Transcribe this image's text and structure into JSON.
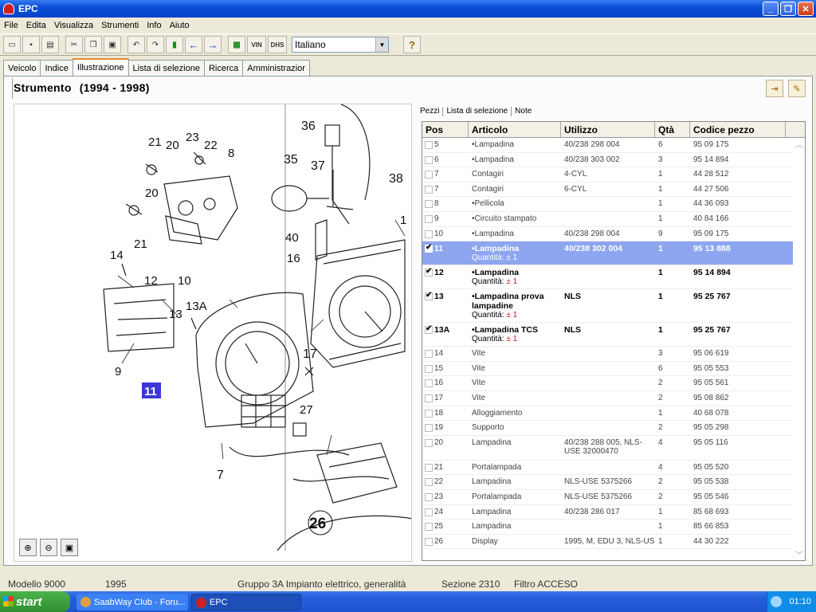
{
  "window": {
    "title": "EPC",
    "min": "_",
    "max": "❐",
    "close": "✕"
  },
  "menu": [
    "File",
    "Edita",
    "Visualizza",
    "Strumenti",
    "Info",
    "Aiuto"
  ],
  "toolbar": {
    "language": "Italiano",
    "vin_label": "VIN",
    "dhs_label": "DHS"
  },
  "tabs": [
    "Veicolo",
    "Indice",
    "Illustrazione",
    "Lista di selezione",
    "Ricerca",
    "Amministrazior"
  ],
  "active_tab": "Illustrazione",
  "page": {
    "title": "Strumento",
    "years": "(1994 - 1998)"
  },
  "subtabs": [
    "Pezzi",
    "Lista di selezione",
    "Note"
  ],
  "columns": {
    "pos": "Pos",
    "articolo": "Articolo",
    "utilizzo": "Utilizzo",
    "qta": "Qtà",
    "codice": "Codice pezzo"
  },
  "qty_label": "Quantità:",
  "rows": [
    {
      "pos": "5",
      "articolo": "•Lampadina",
      "utilizzo": "40/238 298 004",
      "qta": "6",
      "codice": "95 09 175"
    },
    {
      "pos": "6",
      "articolo": "•Lampadina",
      "utilizzo": "40/238 303 002",
      "qta": "3",
      "codice": "95 14 894"
    },
    {
      "pos": "7",
      "articolo": "Contagiri",
      "utilizzo": "4-CYL",
      "qta": "1",
      "codice": "44 28 512"
    },
    {
      "pos": "7",
      "articolo": "Contagiri",
      "utilizzo": "6-CYL",
      "qta": "1",
      "codice": "44 27 506"
    },
    {
      "pos": "8",
      "articolo": "•Pellicola",
      "utilizzo": "",
      "qta": "1",
      "codice": "44 36 093"
    },
    {
      "pos": "9",
      "articolo": "•Circuito stampato",
      "utilizzo": "",
      "qta": "1",
      "codice": "40 84 166"
    },
    {
      "pos": "10",
      "articolo": "•Lampadina",
      "utilizzo": "40/238 298 004",
      "qta": "9",
      "codice": "95 09 175"
    },
    {
      "pos": "11",
      "articolo": "•Lampadina",
      "utilizzo": "40/238 302 004",
      "qta": "1",
      "codice": "95 13 888",
      "qty": "± 1"
    },
    {
      "pos": "12",
      "articolo": "•Lampadina",
      "utilizzo": "",
      "qta": "1",
      "codice": "95 14 894",
      "qty": "± 1"
    },
    {
      "pos": "13",
      "articolo": "•Lampadina prova lampadine",
      "utilizzo": "NLS",
      "qta": "1",
      "codice": "95 25 767",
      "qty": "± 1"
    },
    {
      "pos": "13A",
      "articolo": "•Lampadina TCS",
      "utilizzo": "NLS",
      "qta": "1",
      "codice": "95 25 767",
      "qty": "± 1"
    },
    {
      "pos": "14",
      "articolo": "Vite",
      "utilizzo": "",
      "qta": "3",
      "codice": "95 06 619"
    },
    {
      "pos": "15",
      "articolo": "Vite",
      "utilizzo": "",
      "qta": "6",
      "codice": "95 05 553"
    },
    {
      "pos": "16",
      "articolo": "Vite",
      "utilizzo": "",
      "qta": "2",
      "codice": "95 05 561"
    },
    {
      "pos": "17",
      "articolo": "Vite",
      "utilizzo": "",
      "qta": "2",
      "codice": "95 08 862"
    },
    {
      "pos": "18",
      "articolo": "Alloggiamento",
      "utilizzo": "",
      "qta": "1",
      "codice": "40 68 078"
    },
    {
      "pos": "19",
      "articolo": "Supporto",
      "utilizzo": "",
      "qta": "2",
      "codice": "95 05 298"
    },
    {
      "pos": "20",
      "articolo": "Lampadina",
      "utilizzo": "40/238 288 005, NLS-USE 32000470",
      "qta": "4",
      "codice": "95 05 116"
    },
    {
      "pos": "21",
      "articolo": "Portalampada",
      "utilizzo": "",
      "qta": "4",
      "codice": "95 05 520"
    },
    {
      "pos": "22",
      "articolo": "Lampadina",
      "utilizzo": "NLS-USE 5375266",
      "qta": "2",
      "codice": "95 05 538"
    },
    {
      "pos": "23",
      "articolo": "Portalampada",
      "utilizzo": "NLS-USE 5375266",
      "qta": "2",
      "codice": "95 05 546"
    },
    {
      "pos": "24",
      "articolo": "Lampadina",
      "utilizzo": "40/238 286 017",
      "qta": "1",
      "codice": "85 68 693"
    },
    {
      "pos": "25",
      "articolo": "Lampadina",
      "utilizzo": "",
      "qta": "1",
      "codice": "85 66 853"
    },
    {
      "pos": "26",
      "articolo": "Display",
      "utilizzo": "1995, M, EDU 3, NLS-US",
      "qta": "1",
      "codice": "44 30 222"
    }
  ],
  "callouts": [
    "21",
    "20",
    "23",
    "22",
    "8",
    "36",
    "35",
    "37",
    "38",
    "20",
    "40",
    "1",
    "14",
    "21",
    "16",
    "12",
    "10",
    "13A",
    "13",
    "9",
    "11",
    "17",
    "27",
    "7",
    "26"
  ],
  "status": {
    "modello": "Modello 9000",
    "anno": "1995",
    "gruppo": "Gruppo 3A Impianto elettrico, generalità",
    "sezione": "Sezione 2310",
    "filtro": "Filtro ACCESO"
  },
  "taskbar": {
    "start": "start",
    "task1": "SaabWay Club - Foru...",
    "task2": "EPC",
    "clock": "01:10"
  },
  "colors": {
    "selection": "#8ea6f0",
    "highlight_callout": "#3b36d8",
    "titlebar": "#0a4fd6"
  }
}
